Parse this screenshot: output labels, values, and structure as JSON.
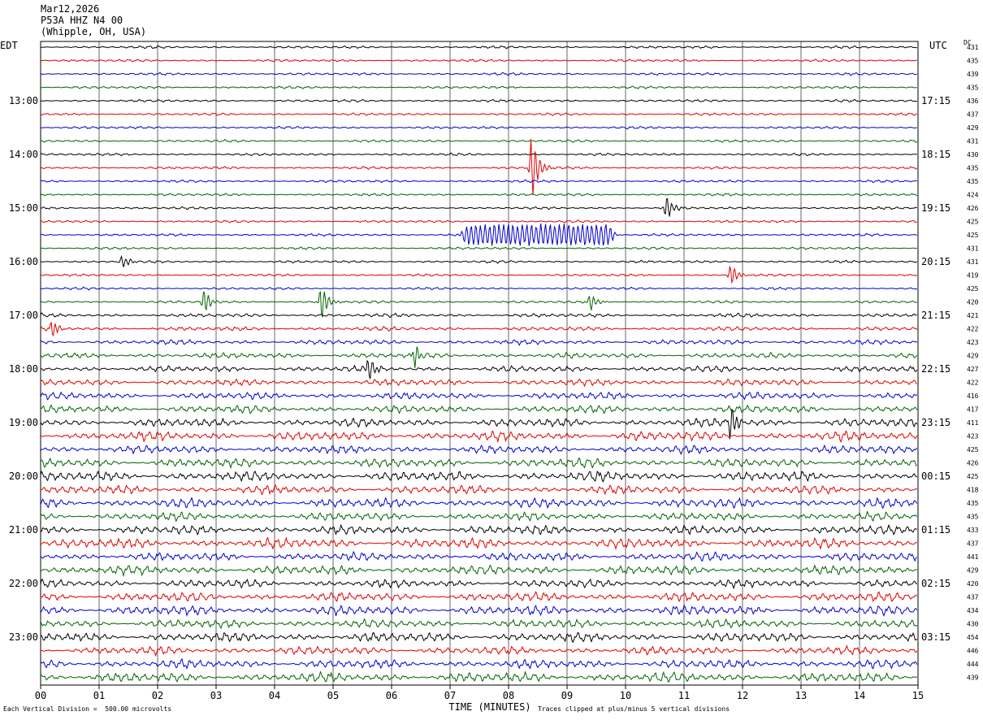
{
  "header": {
    "date": "Mar12,2026",
    "station": "P53A HHZ N4 00",
    "location": "(Whipple, OH, USA)"
  },
  "labels": {
    "left_tz": "EDT",
    "right_tz": "UTC",
    "dc": "DC"
  },
  "footer": {
    "scale": "Each Vertical Division =  500.00 microvolts",
    "clip": "Traces clipped at plus/minus 5 vertical divisions"
  },
  "chart_data": {
    "type": "line",
    "xlabel": "TIME (MINUTES)",
    "xlim": [
      0,
      15
    ],
    "x_ticks": [
      "00",
      "01",
      "02",
      "03",
      "04",
      "05",
      "06",
      "07",
      "08",
      "09",
      "10",
      "11",
      "12",
      "13",
      "14",
      "15"
    ],
    "trace_colors": [
      "#000000",
      "#e00000",
      "#0000cc",
      "#006400"
    ],
    "trace_count": 48,
    "left_hour_labels": [
      "13:00",
      "14:00",
      "15:00",
      "16:00",
      "17:00",
      "18:00",
      "19:00",
      "20:00",
      "21:00",
      "22:00",
      "23:00"
    ],
    "right_hour_labels": [
      "17:15",
      "18:15",
      "19:15",
      "20:15",
      "21:15",
      "22:15",
      "23:15",
      "00:15",
      "01:15",
      "02:15",
      "03:15"
    ],
    "dc_offsets": [
      431,
      435,
      439,
      435,
      436,
      437,
      429,
      431,
      430,
      435,
      435,
      424,
      426,
      425,
      425,
      431,
      431,
      419,
      425,
      420,
      421,
      422,
      423,
      429,
      427,
      422,
      416,
      417,
      411,
      423,
      425,
      426,
      425,
      418,
      435,
      435,
      433,
      437,
      441,
      429,
      420,
      437,
      434,
      430,
      454,
      446,
      444,
      439
    ],
    "events": [
      {
        "trace": 9,
        "minute": 8.4,
        "amp": 6.0
      },
      {
        "trace": 12,
        "minute": 10.7,
        "amp": 2.2
      },
      {
        "trace": 14,
        "minute": 7.3,
        "amp": 1.6,
        "duration": 2.4
      },
      {
        "trace": 16,
        "minute": 1.4,
        "amp": 1.2
      },
      {
        "trace": 17,
        "minute": 11.8,
        "amp": 2.0
      },
      {
        "trace": 19,
        "minute": 2.8,
        "amp": 2.0
      },
      {
        "trace": 19,
        "minute": 4.8,
        "amp": 3.0
      },
      {
        "trace": 19,
        "minute": 9.4,
        "amp": 1.5
      },
      {
        "trace": 21,
        "minute": 0.2,
        "amp": 1.5
      },
      {
        "trace": 23,
        "minute": 6.4,
        "amp": 1.6
      },
      {
        "trace": 24,
        "minute": 5.6,
        "amp": 2.2
      },
      {
        "trace": 28,
        "minute": 11.8,
        "amp": 3.0
      }
    ]
  }
}
